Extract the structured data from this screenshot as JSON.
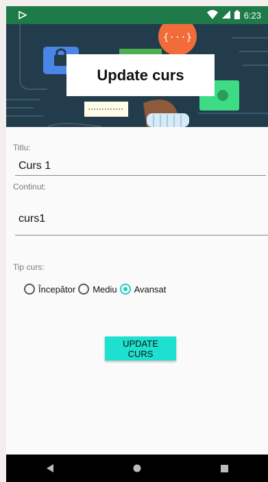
{
  "status_bar": {
    "time": "6:23"
  },
  "header": {
    "title": "Update curs"
  },
  "form": {
    "title_label": "Titlu:",
    "title_value": "Curs 1",
    "content_label": "Continut:",
    "content_value": "curs1",
    "type_label": "Tip curs:",
    "type_options": [
      "Începător",
      "Mediu",
      "Avansat"
    ],
    "type_selected": "Avansat",
    "submit_label": "UPDATE CURS"
  },
  "colors": {
    "status_bar": "#1f7a4a",
    "accent": "#1ee0cf",
    "hero_bg": "#233c4b"
  },
  "icons": [
    "play-store-icon",
    "wifi-icon",
    "signal-icon",
    "battery-icon",
    "back-icon",
    "home-icon",
    "recents-icon"
  ]
}
